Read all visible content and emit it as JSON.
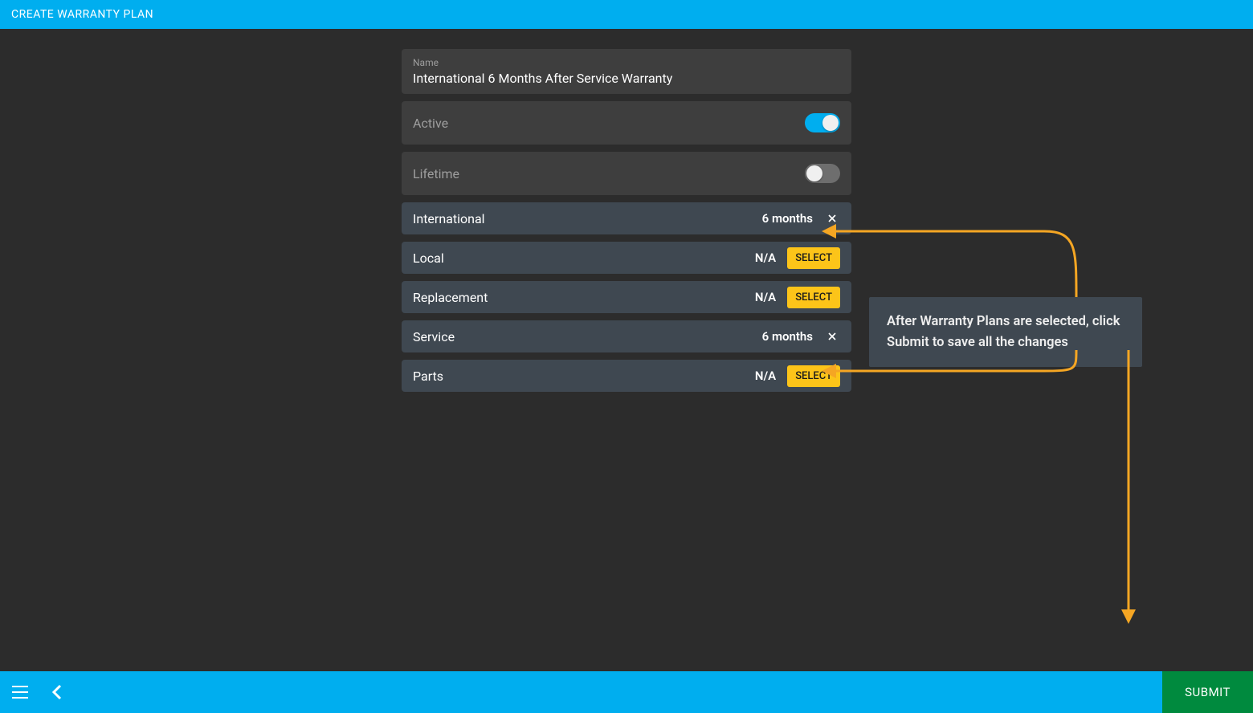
{
  "header": {
    "title": "CREATE WARRANTY PLAN"
  },
  "form": {
    "name_label": "Name",
    "name_value": "International 6 Months After Service Warranty",
    "toggles": [
      {
        "label": "Active",
        "state": "on"
      },
      {
        "label": "Lifetime",
        "state": "off"
      }
    ],
    "rows": [
      {
        "label": "International",
        "value": "6 months",
        "selected": true
      },
      {
        "label": "Local",
        "value": "N/A",
        "selected": false,
        "button": "SELECT"
      },
      {
        "label": "Replacement",
        "value": "N/A",
        "selected": false,
        "button": "SELECT"
      },
      {
        "label": "Service",
        "value": "6 months",
        "selected": true
      },
      {
        "label": "Parts",
        "value": "N/A",
        "selected": false,
        "button": "SELECT"
      }
    ]
  },
  "footer": {
    "submit_label": "SUBMIT"
  },
  "callout": {
    "text": "After Warranty Plans are selected, click Submit to save all the changes"
  },
  "colors": {
    "accent": "#00aeef",
    "select_btn": "#fcc419",
    "submit_btn": "#008a3e",
    "arrow": "#f5a623"
  }
}
